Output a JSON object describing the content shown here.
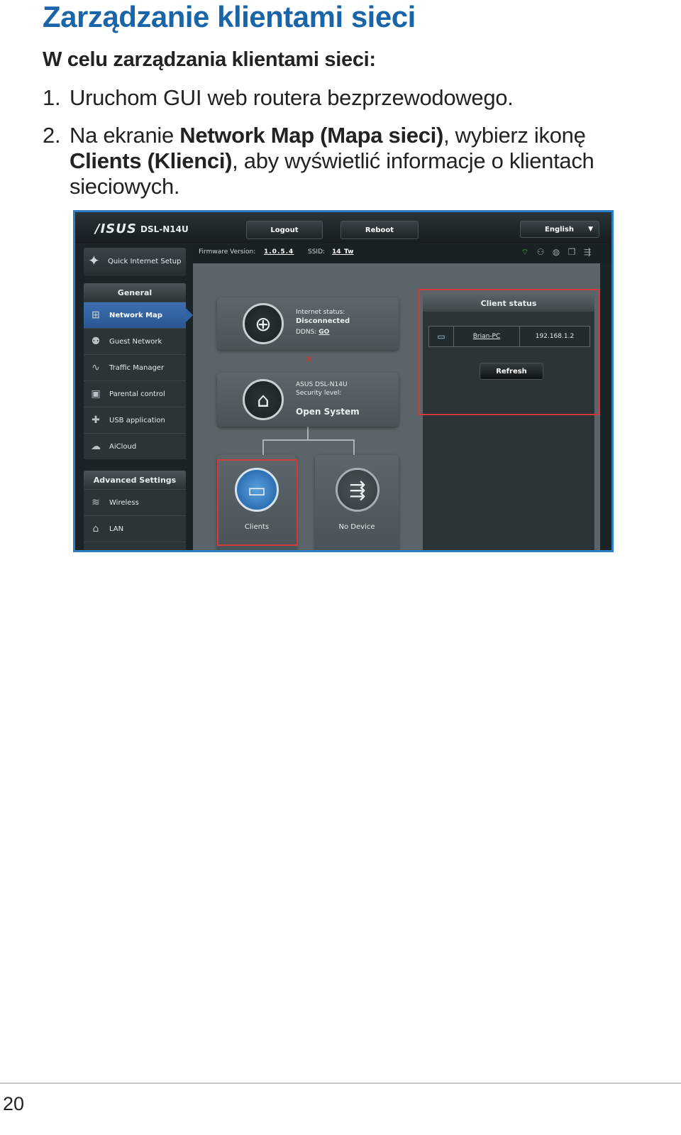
{
  "page": {
    "title": "Zarządzanie klientami sieci",
    "subtitle": "W celu zarządzania klientami sieci:",
    "steps": [
      {
        "num": "1.",
        "text": "Uruchom GUI web routera bezprzewodowego."
      },
      {
        "num": "2.",
        "text_a": "Na ekranie ",
        "bold_a": "Network Map (Mapa sieci)",
        "text_b": ", wybierz ikonę ",
        "bold_b": "Clients (Klienci)",
        "text_c": ", aby wyświetlić informacje o klientach sieciowych."
      }
    ],
    "page_number": "20"
  },
  "router_ui": {
    "brand": "/ISUS",
    "model": "DSL-N14U",
    "buttons": {
      "logout": "Logout",
      "reboot": "Reboot",
      "language": "English"
    },
    "firmware_label": "Firmware Version:",
    "firmware_value": "1.0.5.4",
    "ssid_label": "SSID:",
    "ssid_value": "14_Tw",
    "quick_setup": "Quick Internet Setup",
    "general_header": "General",
    "general_items": [
      {
        "label": "Network Map",
        "icon": "network-map-icon"
      },
      {
        "label": "Guest Network",
        "icon": "guest-network-icon"
      },
      {
        "label": "Traffic Manager",
        "icon": "traffic-manager-icon"
      },
      {
        "label": "Parental control",
        "icon": "lock-icon"
      },
      {
        "label": "USB application",
        "icon": "puzzle-icon"
      },
      {
        "label": "AiCloud",
        "icon": "cloud-icon"
      }
    ],
    "advanced_header": "Advanced Settings",
    "advanced_items": [
      {
        "label": "Wireless",
        "icon": "wifi-icon"
      },
      {
        "label": "LAN",
        "icon": "home-icon"
      }
    ],
    "internet": {
      "status_label": "Internet status:",
      "status_value": "Disconnected",
      "ddns_label": "DDNS:",
      "ddns_value": "GO"
    },
    "router": {
      "model": "ASUS DSL-N14U",
      "security_label": "Security level:",
      "security_value": "Open System"
    },
    "devices": {
      "clients": "Clients",
      "usb": "No Device"
    },
    "client_status": {
      "title": "Client status",
      "clients": [
        {
          "name": "Brian-PC",
          "ip": "192.168.1.2"
        }
      ],
      "refresh": "Refresh"
    },
    "colors": {
      "accent": "#2f7dc3",
      "highlight": "#d23a3a",
      "title_blue": "#1a64a8"
    }
  }
}
